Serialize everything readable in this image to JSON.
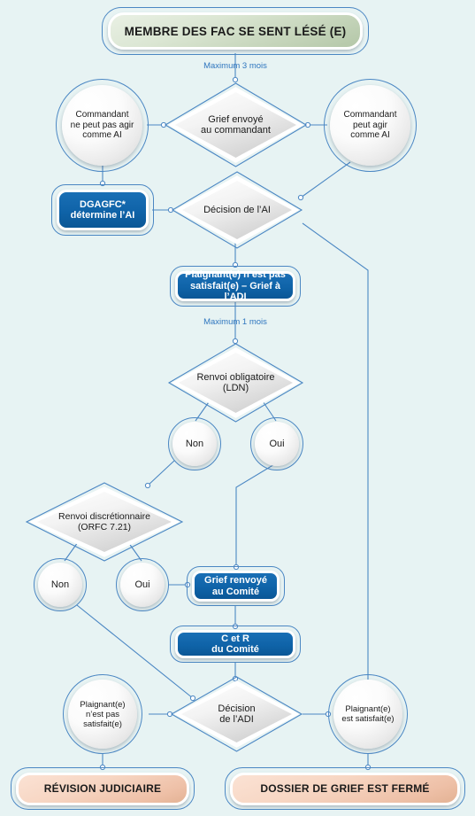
{
  "meta": {
    "background_color": "#e7f3f3",
    "accent_blue": "#0f63a8",
    "line_color": "#4b87c3",
    "text_dark": "#1a1a1a",
    "green_terminal": "#c3d3b8",
    "peach_terminal": "#eec0a7",
    "edge_label_color": "#2f76bf"
  },
  "flowchart": {
    "title": "MEMBRE DES FAC SE SENT LÉSÉ (E)",
    "nodes": {
      "start": {
        "label": "MEMBRE DES FAC SE SENT LÉSÉ (E)",
        "shape": "terminal",
        "color": "green"
      },
      "grief_envoye_cmdt": {
        "line1": "Grief envoyé",
        "line2": "au commandant",
        "shape": "decision"
      },
      "cmdt_ne_peut_pas": {
        "line1": "Commandant",
        "line2": "ne peut pas agir",
        "line3": "comme AI",
        "shape": "circle"
      },
      "cmdt_peut_agir": {
        "line1": "Commandant",
        "line2": "peut agir",
        "line3": "comme AI",
        "shape": "circle"
      },
      "dgagfc": {
        "line1": "DGAGFC*",
        "line2": "détermine l’AI",
        "shape": "process",
        "color": "blue"
      },
      "decision_ai": {
        "label": "Décision de l’AI",
        "shape": "decision"
      },
      "plaignant_non_satisfait_adi": {
        "line1": "Plaignant(e) n’est pas",
        "line2": "satisfait(e) – Grief à l’ADI",
        "shape": "process",
        "color": "blue"
      },
      "renvoi_obligatoire": {
        "line1": "Renvoi obligatoire",
        "line2": "(LDN)",
        "shape": "decision"
      },
      "ldn_non": {
        "label": "Non",
        "shape": "circle"
      },
      "ldn_oui": {
        "label": "Oui",
        "shape": "circle"
      },
      "renvoi_discretionnaire": {
        "line1": "Renvoi discrétionnaire",
        "line2": "(ORFC 7.21)",
        "shape": "decision"
      },
      "orfc_non": {
        "label": "Non",
        "shape": "circle"
      },
      "orfc_oui": {
        "label": "Oui",
        "shape": "circle"
      },
      "grief_renvoye_comite": {
        "line1": "Grief renvoyé",
        "line2": "au Comité",
        "shape": "process",
        "color": "blue"
      },
      "c_et_r_comite": {
        "line1": "C et R",
        "line2": "du Comité",
        "shape": "process",
        "color": "blue"
      },
      "decision_adi": {
        "line1": "Décision",
        "line2": "de l’ADI",
        "shape": "decision"
      },
      "plaignant_non_satisfait": {
        "line1": "Plaignant(e)",
        "line2": "n’est pas",
        "line3": "satisfait(e)",
        "shape": "circle"
      },
      "plaignant_satisfait": {
        "line1": "Plaignant(e)",
        "line2": "est satisfait(e)",
        "shape": "circle"
      },
      "revision_judiciaire": {
        "label": "RÉVISION JUDICIAIRE",
        "shape": "terminal",
        "color": "peach"
      },
      "dossier_ferme": {
        "label": "DOSSIER DE GRIEF EST FERMÉ",
        "shape": "terminal",
        "color": "peach"
      }
    },
    "edge_labels": {
      "max_3_mois": "Maximum 3 mois",
      "max_1_mois": "Maximum 1 mois"
    }
  }
}
